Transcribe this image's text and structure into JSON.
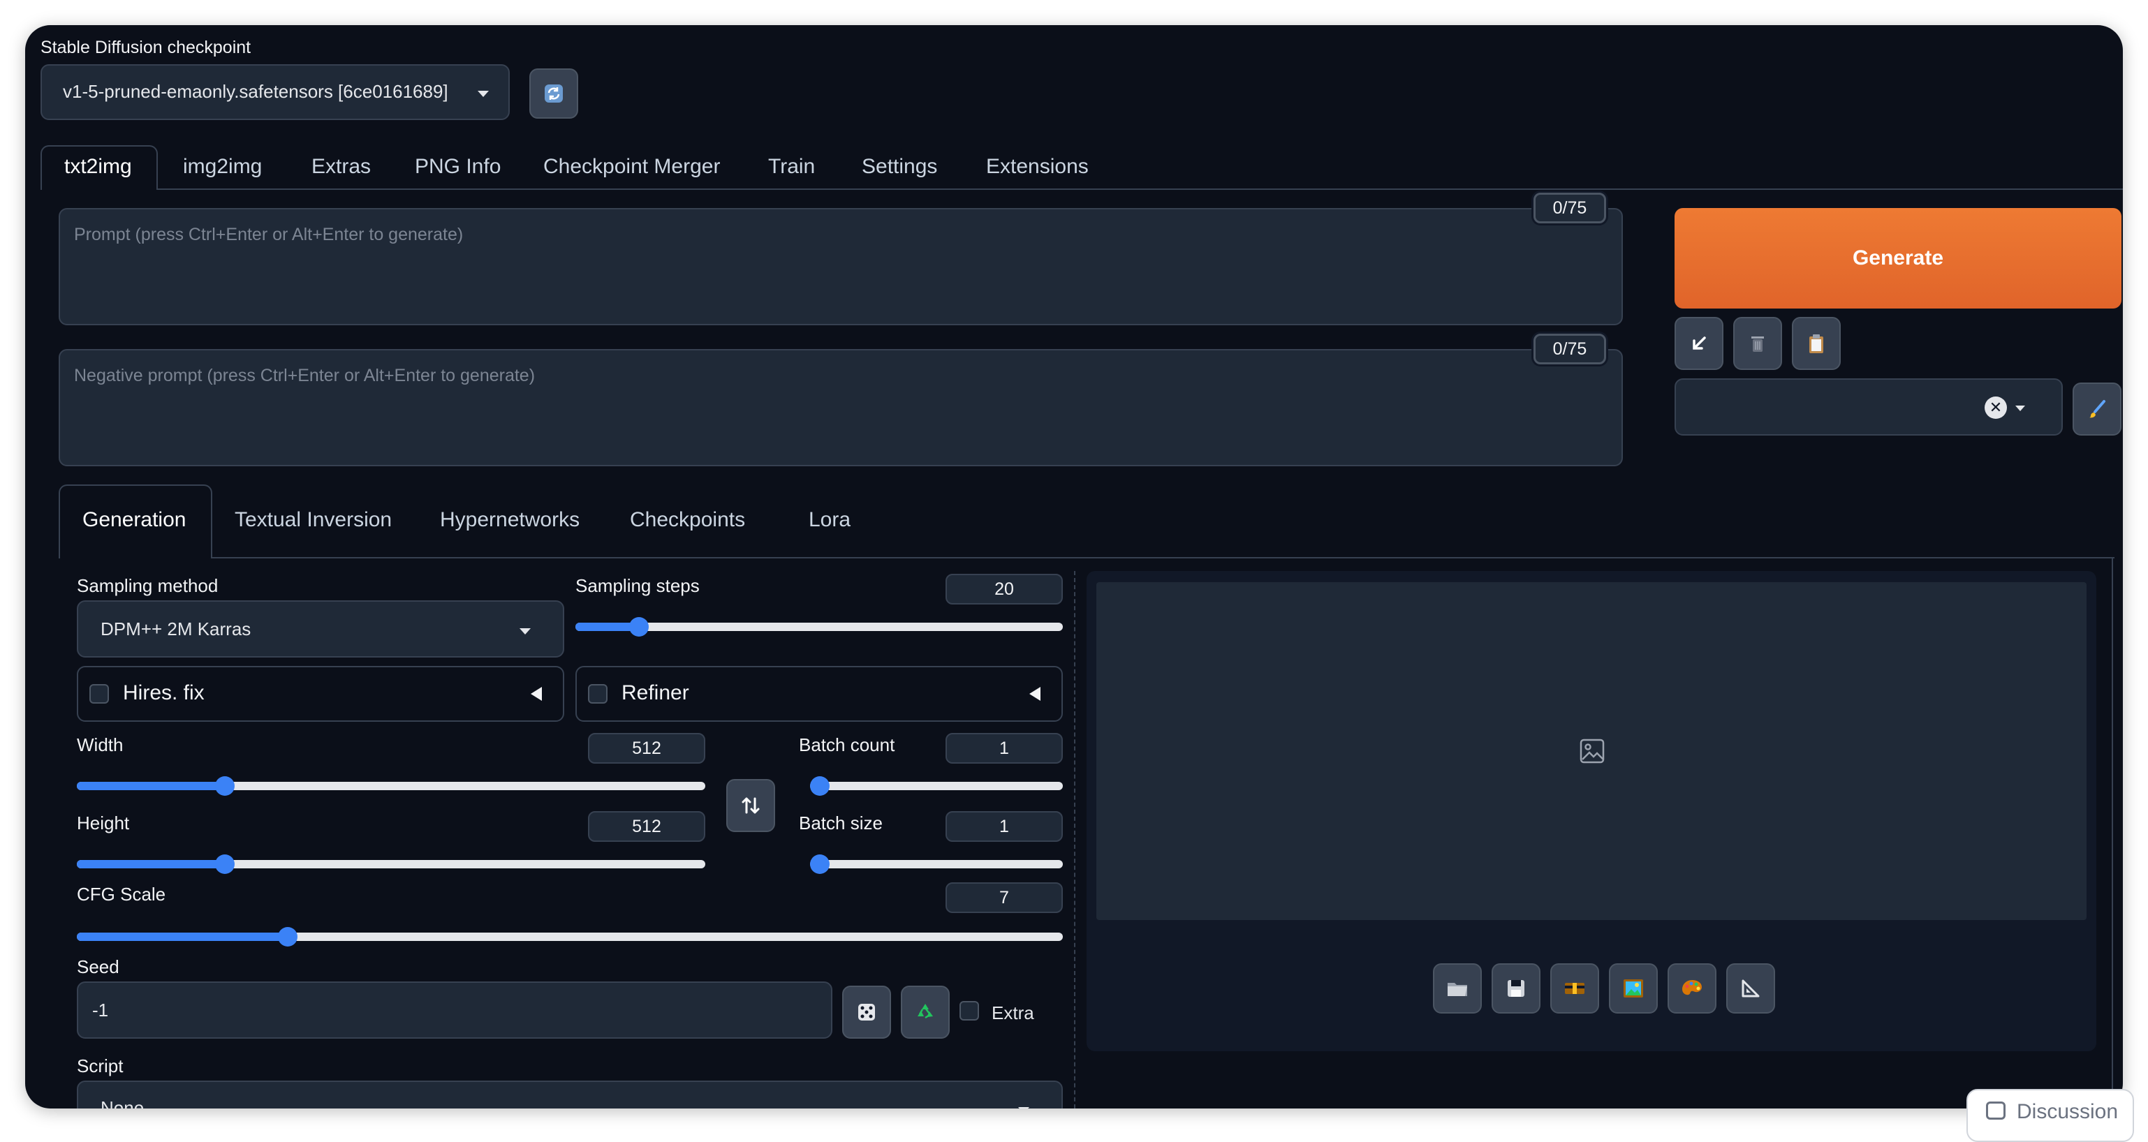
{
  "checkpoint": {
    "label": "Stable Diffusion checkpoint",
    "value": "v1-5-pruned-emaonly.safetensors [6ce0161689]"
  },
  "main_tabs": [
    "txt2img",
    "img2img",
    "Extras",
    "PNG Info",
    "Checkpoint Merger",
    "Train",
    "Settings",
    "Extensions"
  ],
  "prompt": {
    "placeholder": "Prompt (press Ctrl+Enter or Alt+Enter to generate)",
    "counter": "0/75"
  },
  "negative_prompt": {
    "placeholder": "Negative prompt (press Ctrl+Enter or Alt+Enter to generate)",
    "counter": "0/75"
  },
  "generate_label": "Generate",
  "sub_tabs": [
    "Generation",
    "Textual Inversion",
    "Hypernetworks",
    "Checkpoints",
    "Lora"
  ],
  "sampling_method": {
    "label": "Sampling method",
    "value": "DPM++ 2M Karras"
  },
  "sampling_steps": {
    "label": "Sampling steps",
    "value": "20",
    "fraction": 0.13
  },
  "hires_fix": {
    "label": "Hires. fix"
  },
  "refiner": {
    "label": "Refiner"
  },
  "width": {
    "label": "Width",
    "value": "512",
    "fraction": 0.235
  },
  "height": {
    "label": "Height",
    "value": "512",
    "fraction": 0.235
  },
  "batch_count": {
    "label": "Batch count",
    "value": "1",
    "fraction": 0.0
  },
  "batch_size": {
    "label": "Batch size",
    "value": "1",
    "fraction": 0.0
  },
  "cfg_scale": {
    "label": "CFG Scale",
    "value": "7",
    "fraction": 0.214
  },
  "seed": {
    "label": "Seed",
    "value": "-1",
    "extra_label": "Extra"
  },
  "script": {
    "label": "Script",
    "value": "None"
  },
  "discussion_label": "Discussion",
  "colors": {
    "background": "#0b0f19",
    "panel": "#1f2937",
    "accent_orange": "#e8712b",
    "slider_blue": "#3b82f6"
  }
}
